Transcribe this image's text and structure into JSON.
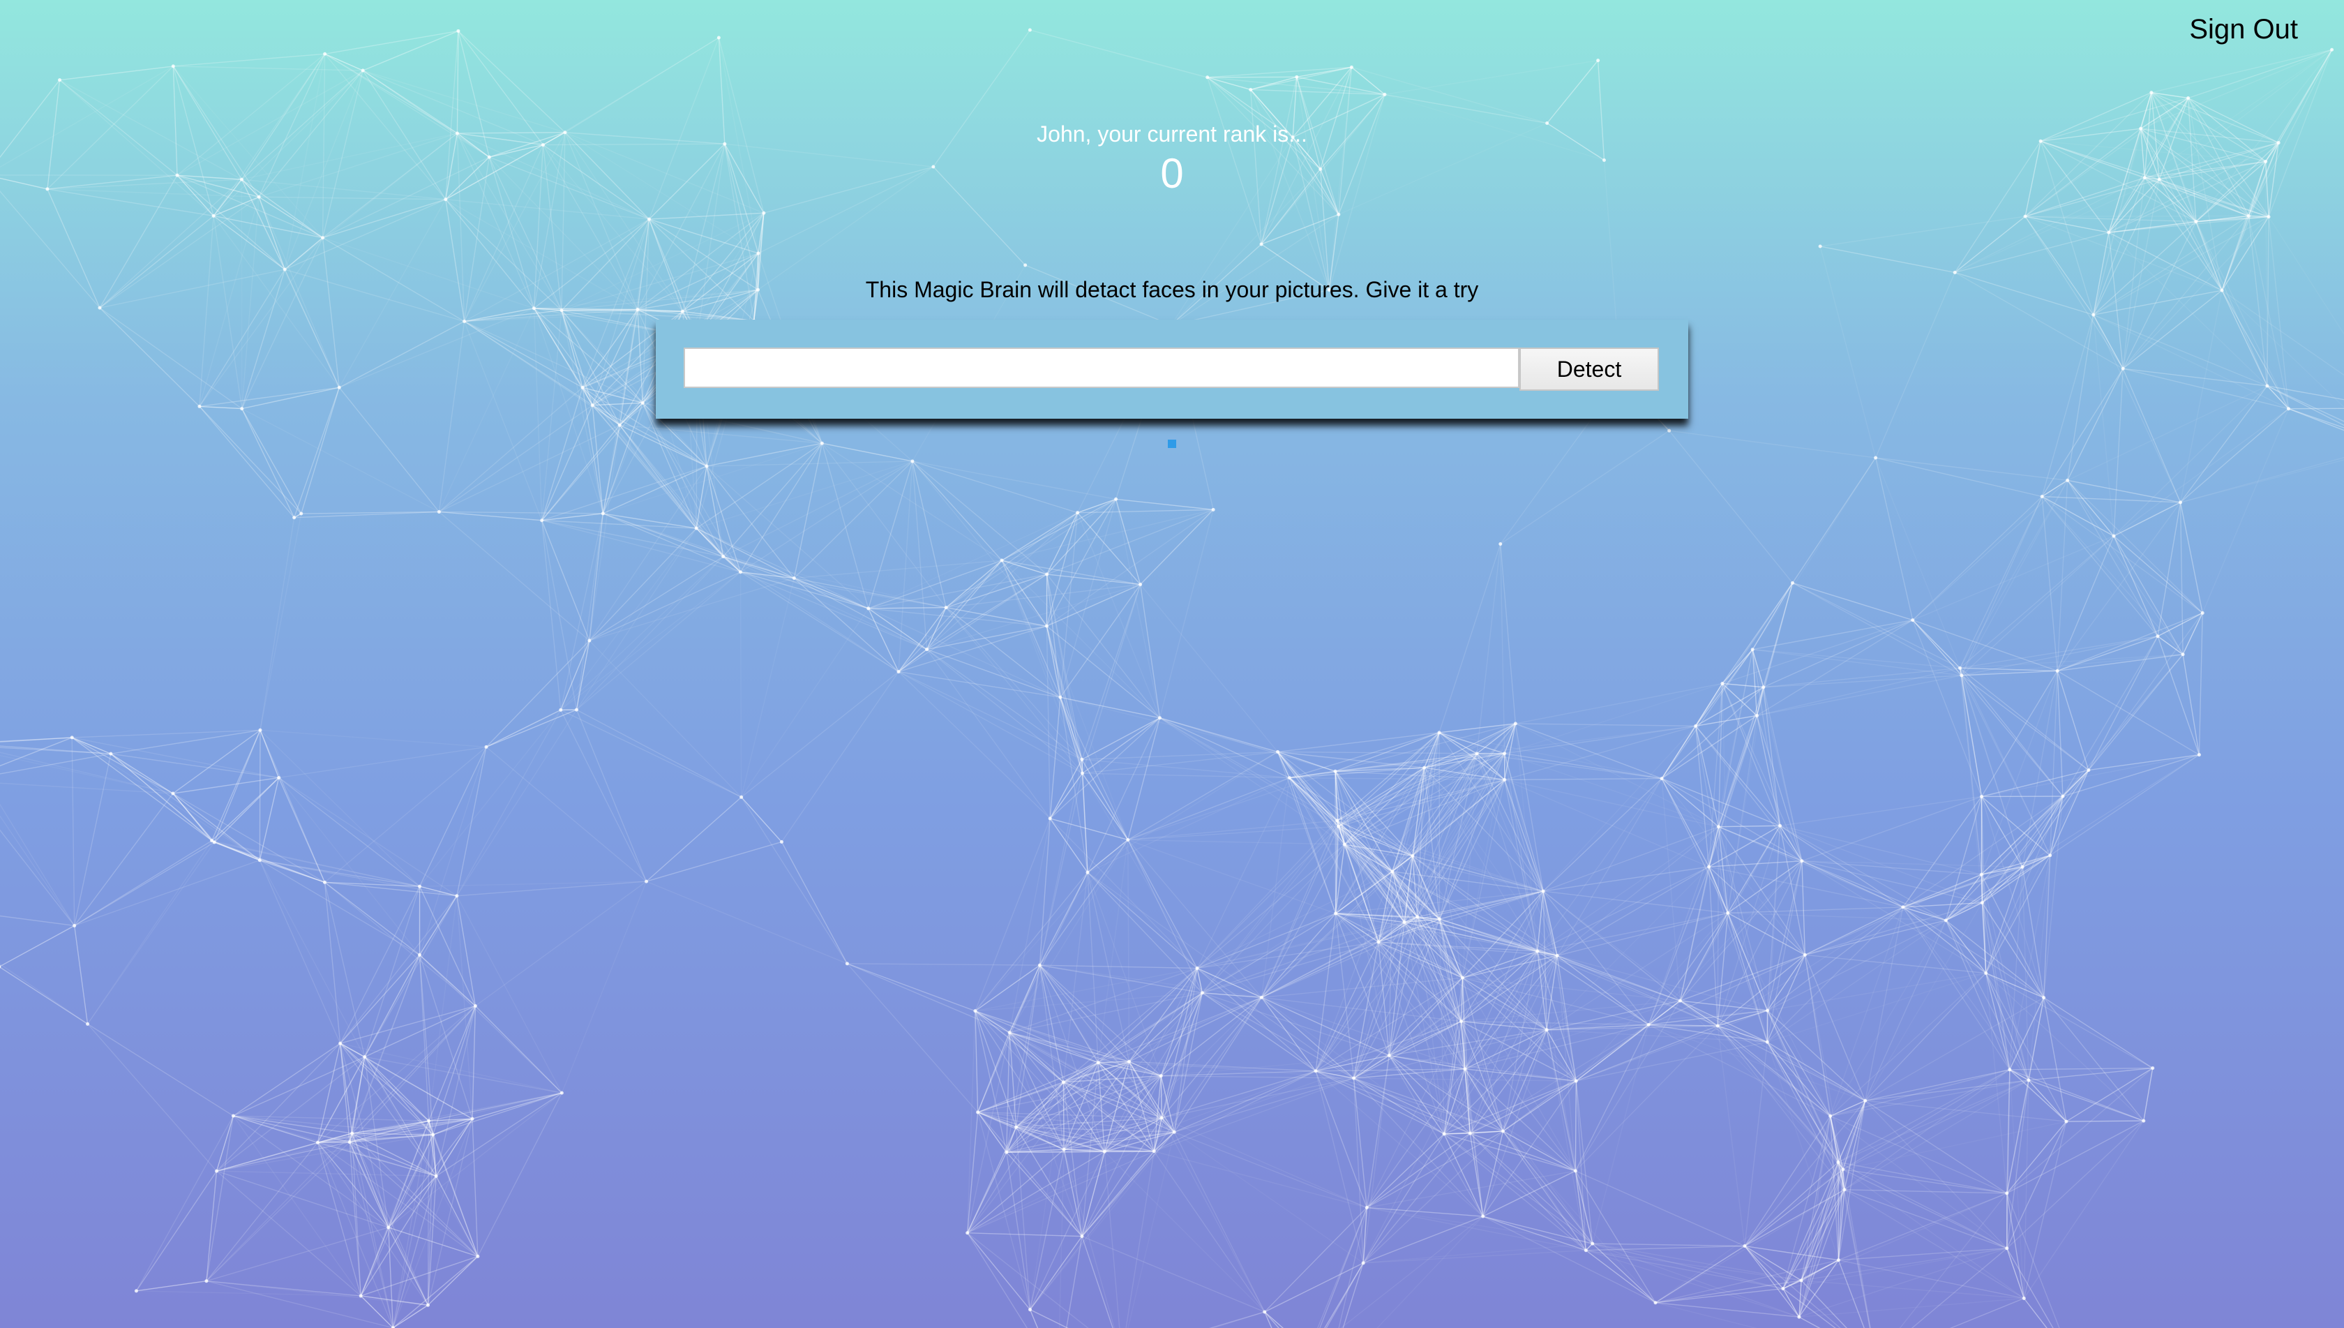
{
  "nav": {
    "sign_out_label": "Sign Out"
  },
  "rank": {
    "title": "John, your current rank is...",
    "value": "0"
  },
  "intro": {
    "text": "This Magic Brain will detact faces in your pictures. Give it a try"
  },
  "form": {
    "url_value": "",
    "url_placeholder": "",
    "detect_label": "Detect"
  },
  "colors": {
    "gradient_top": "#93e7de",
    "gradient_bottom": "#7f85d6",
    "panel": "#87c3e0",
    "image_placeholder": "#2f9be8"
  },
  "icons": {
    "background": "particle-network",
    "image_placeholder": "broken-image-icon"
  }
}
